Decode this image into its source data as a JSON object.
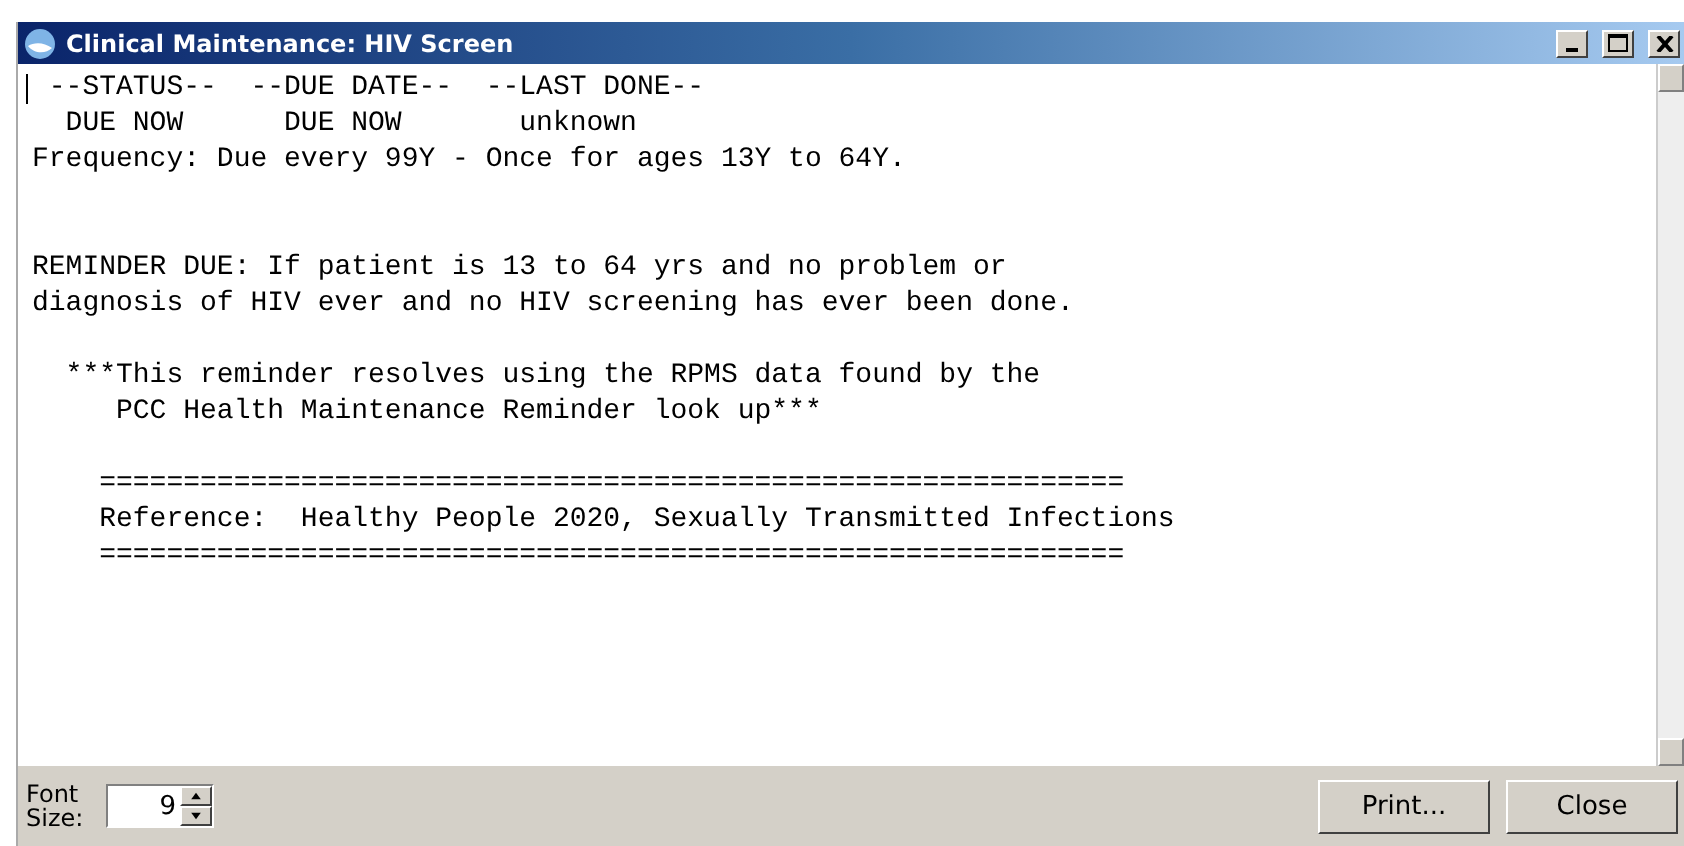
{
  "window": {
    "title": "Clinical Maintenance: HIV Screen"
  },
  "report": {
    "paragraphs": [
      {
        "lines": [
          " --STATUS--  --DUE DATE--  --LAST DONE--",
          "  DUE NOW      DUE NOW       unknown",
          "Frequency: Due every 99Y - Once for ages 13Y to 64Y."
        ]
      },
      {
        "lines": [
          "REMINDER DUE: If patient is 13 to 64 yrs and no problem or",
          "diagnosis of HIV ever and no HIV screening has ever been done."
        ]
      },
      {
        "lines": [
          "  ***This reminder resolves using the RPMS data found by the",
          "     PCC Health Maintenance Reminder look up***"
        ]
      },
      {
        "lines": [
          "    =============================================================",
          "    Reference:  Healthy People 2020, Sexually Transmitted Infections",
          "    ============================================================="
        ]
      }
    ]
  },
  "font_size": {
    "label": "Font Size:",
    "value": "9"
  },
  "buttons": [
    "Print...",
    "Close"
  ]
}
